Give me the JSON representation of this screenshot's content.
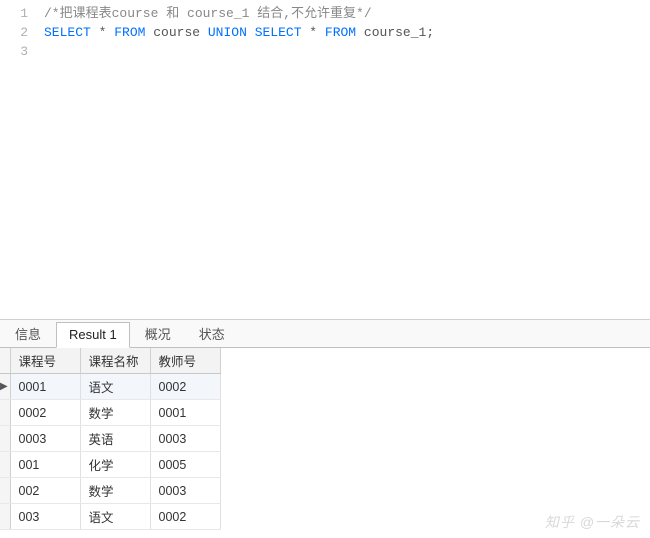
{
  "editor": {
    "lines": [
      {
        "n": "1",
        "tokens": [
          {
            "t": "/*把课程表course 和 course_1 结合,不允许重复*/",
            "cls": "cmt"
          }
        ]
      },
      {
        "n": "2",
        "tokens": [
          {
            "t": "SELECT",
            "cls": "kw"
          },
          {
            "t": " * ",
            "cls": ""
          },
          {
            "t": "FROM",
            "cls": "kw"
          },
          {
            "t": " course ",
            "cls": ""
          },
          {
            "t": "UNION",
            "cls": "kw"
          },
          {
            "t": " ",
            "cls": ""
          },
          {
            "t": "SELECT",
            "cls": "kw"
          },
          {
            "t": " * ",
            "cls": ""
          },
          {
            "t": "FROM",
            "cls": "kw"
          },
          {
            "t": " course_1;",
            "cls": ""
          }
        ]
      },
      {
        "n": "3",
        "tokens": []
      }
    ]
  },
  "tabs": {
    "items": [
      {
        "label": "信息",
        "active": false
      },
      {
        "label": "Result 1",
        "active": true
      },
      {
        "label": "概况",
        "active": false
      },
      {
        "label": "状态",
        "active": false
      }
    ]
  },
  "result": {
    "columns": [
      "课程号",
      "课程名称",
      "教师号"
    ],
    "rows": [
      {
        "marker": "▶",
        "cells": [
          "0001",
          "语文",
          "0002"
        ],
        "current": true
      },
      {
        "marker": "",
        "cells": [
          "0002",
          "数学",
          "0001"
        ],
        "current": false
      },
      {
        "marker": "",
        "cells": [
          "0003",
          "英语",
          "0003"
        ],
        "current": false
      },
      {
        "marker": "",
        "cells": [
          "001",
          "化学",
          "0005"
        ],
        "current": false
      },
      {
        "marker": "",
        "cells": [
          "002",
          "数学",
          "0003"
        ],
        "current": false
      },
      {
        "marker": "",
        "cells": [
          "003",
          "语文",
          "0002"
        ],
        "current": false
      }
    ]
  },
  "watermark": "知乎 @一朵云"
}
